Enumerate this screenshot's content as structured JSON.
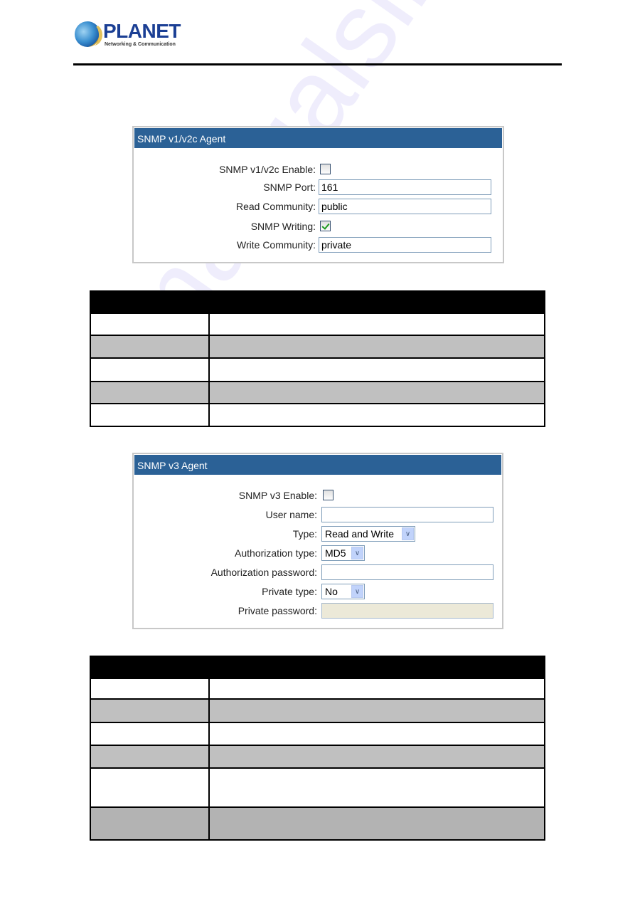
{
  "header": {
    "brand": "PLANET",
    "tagline": "Networking & Communication"
  },
  "colors": {
    "panel_title_bg": "#2b6196",
    "table_header_bg": "#000000",
    "table_row_gray": "#c0c0c0",
    "checkmark": "#1d9a1d"
  },
  "v2c_panel": {
    "title": "SNMP v1/v2c Agent",
    "fields": {
      "enable": {
        "label": "SNMP v1/v2c Enable:",
        "checked": false
      },
      "port": {
        "label": "SNMP Port:",
        "value": "161"
      },
      "read_community": {
        "label": "Read Community:",
        "value": "public"
      },
      "writing": {
        "label": "SNMP Writing:",
        "checked": true
      },
      "write_community": {
        "label": "Write Community:",
        "value": "private"
      }
    }
  },
  "v2c_table": {
    "header": [
      "",
      ""
    ],
    "rows": [
      [
        "",
        ""
      ],
      [
        "",
        ""
      ],
      [
        "",
        ""
      ],
      [
        "",
        ""
      ],
      [
        "",
        ""
      ]
    ]
  },
  "v3_panel": {
    "title": "SNMP v3 Agent",
    "fields": {
      "enable": {
        "label": "SNMP v3 Enable:",
        "checked": false
      },
      "user_name": {
        "label": "User name:",
        "value": ""
      },
      "type": {
        "label": "Type:",
        "value": "Read and Write"
      },
      "auth_type": {
        "label": "Authorization type:",
        "value": "MD5"
      },
      "auth_password": {
        "label": "Authorization password:",
        "value": ""
      },
      "private_type": {
        "label": "Private type:",
        "value": "No"
      },
      "private_password": {
        "label": "Private password:",
        "value": "",
        "disabled": true
      }
    }
  },
  "v3_table": {
    "header": [
      "",
      ""
    ],
    "rows": [
      [
        "",
        ""
      ],
      [
        "",
        ""
      ],
      [
        "",
        ""
      ],
      [
        "",
        ""
      ],
      [
        "",
        ""
      ],
      [
        "",
        ""
      ]
    ]
  },
  "watermark": "manualslive.com"
}
